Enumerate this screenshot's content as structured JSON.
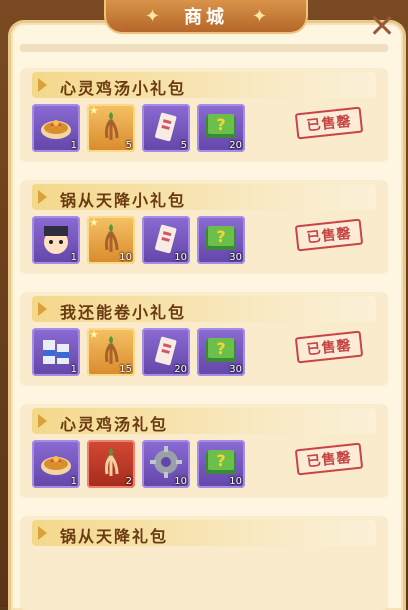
{
  "header": {
    "title": "商城"
  },
  "colors": {
    "accent": "#d9934a",
    "stamp": "#c64545",
    "panel": "#fff6e2"
  },
  "packs": [
    {
      "name": "心灵鸡汤小礼包",
      "status": "已售罄",
      "items": [
        {
          "icon": "chicken-soup-icon",
          "bg": "purple",
          "count": "1"
        },
        {
          "icon": "ginseng-icon",
          "bg": "gold",
          "count": "5",
          "star": true
        },
        {
          "icon": "scroll-icon",
          "bg": "purple",
          "count": "5"
        },
        {
          "icon": "mystery-book-icon",
          "bg": "purple",
          "count": "20"
        }
      ]
    },
    {
      "name": "锅从天降小礼包",
      "status": "已售罄",
      "items": [
        {
          "icon": "chef-avatar-icon",
          "bg": "purple",
          "count": "1"
        },
        {
          "icon": "ginseng-icon",
          "bg": "gold",
          "count": "10",
          "star": true
        },
        {
          "icon": "scroll-icon",
          "bg": "purple",
          "count": "10"
        },
        {
          "icon": "mystery-book-icon",
          "bg": "purple",
          "count": "30"
        }
      ]
    },
    {
      "name": "我还能卷小礼包",
      "status": "已售罄",
      "items": [
        {
          "icon": "milk-carton-icon",
          "bg": "purple",
          "count": "1"
        },
        {
          "icon": "ginseng-icon",
          "bg": "gold",
          "count": "15",
          "star": true
        },
        {
          "icon": "scroll-icon",
          "bg": "purple",
          "count": "20"
        },
        {
          "icon": "mystery-book-icon",
          "bg": "purple",
          "count": "30"
        }
      ]
    },
    {
      "name": "心灵鸡汤礼包",
      "status": "已售罄",
      "items": [
        {
          "icon": "chicken-soup-icon",
          "bg": "purple",
          "count": "1"
        },
        {
          "icon": "red-ginseng-icon",
          "bg": "red",
          "count": "2"
        },
        {
          "icon": "gear-icon",
          "bg": "purple",
          "count": "10"
        },
        {
          "icon": "mystery-book-icon",
          "bg": "purple",
          "count": "10"
        }
      ]
    },
    {
      "name": "锅从天降礼包",
      "status": "",
      "items": []
    }
  ]
}
